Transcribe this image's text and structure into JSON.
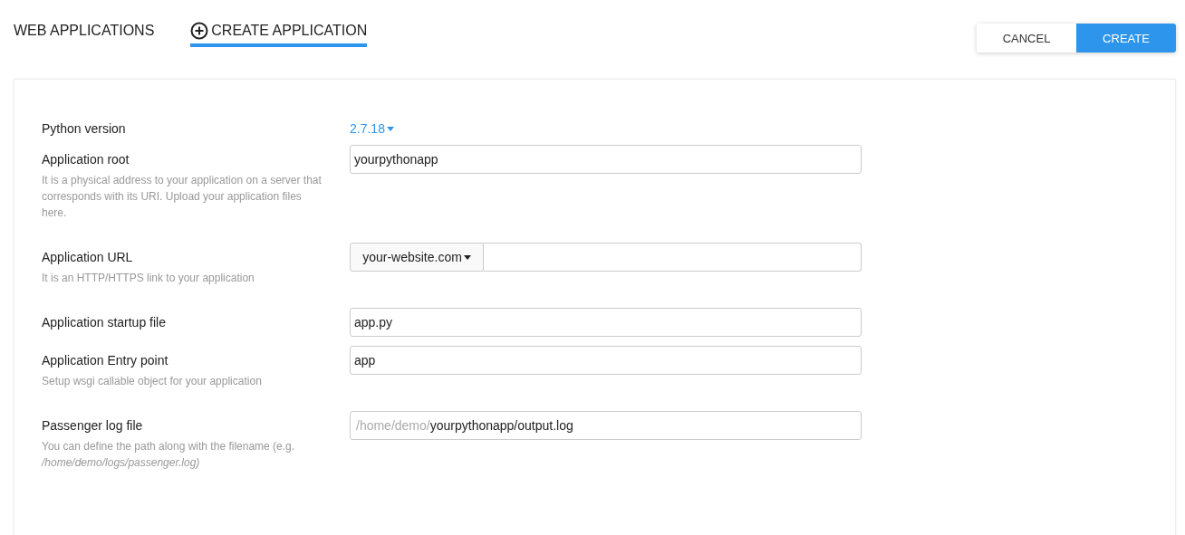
{
  "tabs": [
    {
      "label": "WEB APPLICATIONS",
      "selected": false,
      "kind": "plain"
    },
    {
      "label": "CREATE APPLICATION",
      "selected": true,
      "kind": "add"
    }
  ],
  "actions": [
    {
      "label": "CANCEL",
      "kind": "secondary"
    },
    {
      "label": "CREATE",
      "kind": "primary"
    }
  ],
  "form": {
    "fields": [
      {
        "kind": "dropdown",
        "label": "Python version",
        "value": "2.7.18"
      },
      {
        "kind": "text",
        "label": "Application root",
        "value": "yourpythonapp",
        "hint": "It is a physical address to your application on a server that corresponds with its URI. Upload your application files here."
      },
      {
        "kind": "url",
        "label": "Application URL",
        "domain": "your-website.com",
        "hint": "It is an HTTP/HTTPS link to your application"
      },
      {
        "kind": "text",
        "label": "Application startup file",
        "value": "app.py"
      },
      {
        "kind": "text",
        "label": "Application Entry point",
        "value": "app",
        "hint": "Setup wsgi callable object for your application"
      },
      {
        "kind": "path",
        "label": "Passenger log file",
        "prefix": "/home/demo/",
        "value": "yourpythonapp/output.log",
        "hint": "You can define the path along with the filename (e.g. */home/demo/logs/passenger.log)*"
      }
    ]
  }
}
